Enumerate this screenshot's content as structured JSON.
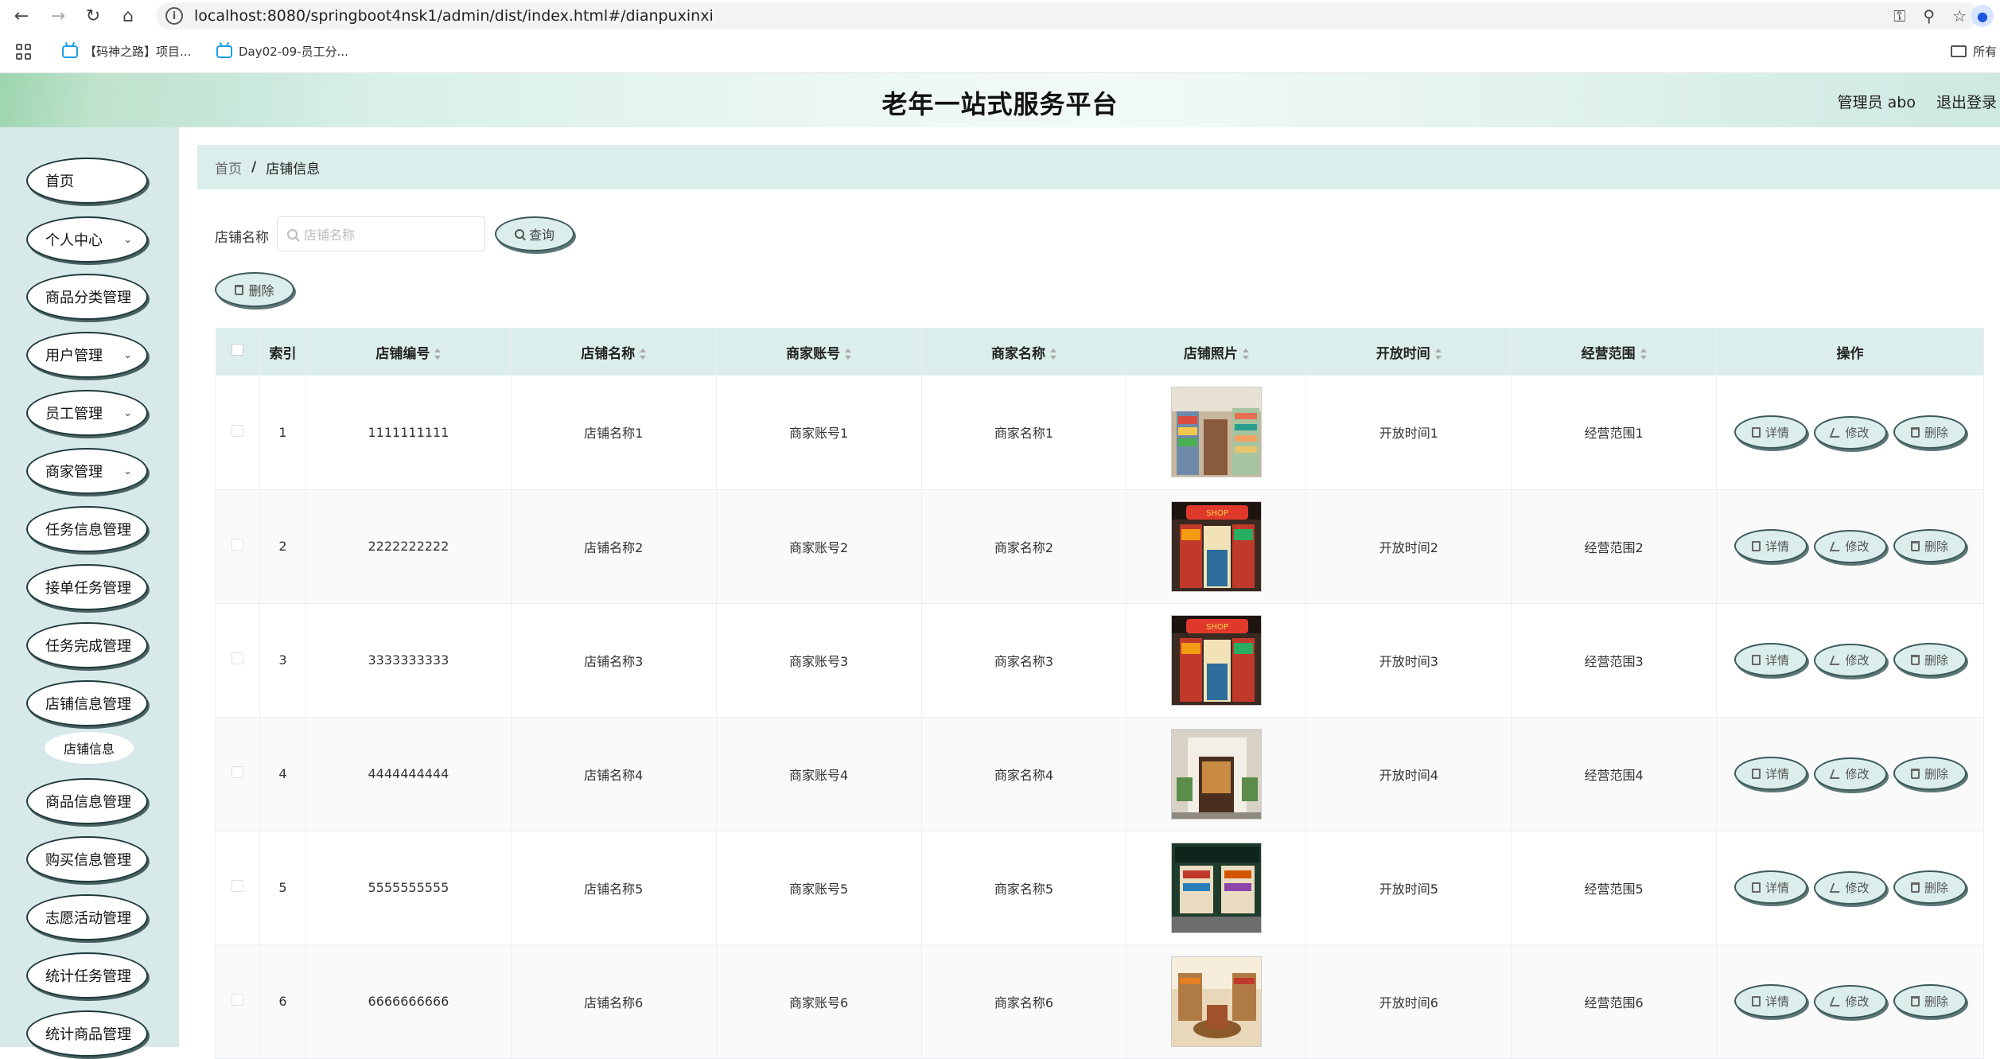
{
  "browser": {
    "url": "localhost:8080/springboot4nsk1/admin/dist/index.html#/dianpuxinxi",
    "bookmarks": [
      "【码神之路】项目...",
      "Day02-09-员工分..."
    ],
    "bookmarks_folder": "所有"
  },
  "header": {
    "title": "老年一站式服务平台",
    "admin_label": "管理员 abo",
    "logout_label": "退出登录"
  },
  "sidebar": {
    "items": [
      {
        "label": "首页",
        "expandable": false
      },
      {
        "label": "个人中心",
        "expandable": true
      },
      {
        "label": "商品分类管理",
        "expandable": false
      },
      {
        "label": "用户管理",
        "expandable": true
      },
      {
        "label": "员工管理",
        "expandable": true
      },
      {
        "label": "商家管理",
        "expandable": true
      },
      {
        "label": "任务信息管理",
        "expandable": false
      },
      {
        "label": "接单任务管理",
        "expandable": false
      },
      {
        "label": "任务完成管理",
        "expandable": false
      },
      {
        "label": "店铺信息管理",
        "expandable": false
      },
      {
        "label": "商品信息管理",
        "expandable": false
      },
      {
        "label": "购买信息管理",
        "expandable": false
      },
      {
        "label": "志愿活动管理",
        "expandable": false
      },
      {
        "label": "统计任务管理",
        "expandable": false
      },
      {
        "label": "统计商品管理",
        "expandable": false
      }
    ],
    "submenu": {
      "label": "店铺信息"
    }
  },
  "breadcrumb": {
    "home": "首页",
    "separator": "/",
    "current": "店铺信息"
  },
  "search": {
    "label": "店铺名称",
    "placeholder": "店铺名称",
    "query_button": "查询",
    "delete_button": "删除"
  },
  "table": {
    "columns": [
      "索引",
      "店铺编号",
      "店铺名称",
      "商家账号",
      "商家名称",
      "店铺照片",
      "开放时间",
      "经营范围",
      "操作"
    ],
    "sortable": [
      false,
      true,
      true,
      true,
      true,
      true,
      true,
      true,
      false
    ],
    "actions": {
      "detail": "详情",
      "edit": "修改",
      "delete": "删除"
    },
    "rows": [
      {
        "index": "1",
        "shop_no": "1111111111",
        "shop_name": "店铺名称1",
        "merchant_account": "商家账号1",
        "merchant_name": "商家名称1",
        "open_time": "开放时间1",
        "scope": "经营范围1",
        "photo": "shop-photo-1"
      },
      {
        "index": "2",
        "shop_no": "2222222222",
        "shop_name": "店铺名称2",
        "merchant_account": "商家账号2",
        "merchant_name": "商家名称2",
        "open_time": "开放时间2",
        "scope": "经营范围2",
        "photo": "shop-photo-2"
      },
      {
        "index": "3",
        "shop_no": "3333333333",
        "shop_name": "店铺名称3",
        "merchant_account": "商家账号3",
        "merchant_name": "商家名称3",
        "open_time": "开放时间3",
        "scope": "经营范围3",
        "photo": "shop-photo-3"
      },
      {
        "index": "4",
        "shop_no": "4444444444",
        "shop_name": "店铺名称4",
        "merchant_account": "商家账号4",
        "merchant_name": "商家名称4",
        "open_time": "开放时间4",
        "scope": "经营范围4",
        "photo": "shop-photo-4"
      },
      {
        "index": "5",
        "shop_no": "5555555555",
        "shop_name": "店铺名称5",
        "merchant_account": "商家账号5",
        "merchant_name": "商家名称5",
        "open_time": "开放时间5",
        "scope": "经营范围5",
        "photo": "shop-photo-5"
      },
      {
        "index": "6",
        "shop_no": "6666666666",
        "shop_name": "店铺名称6",
        "merchant_account": "商家账号6",
        "merchant_name": "商家名称6",
        "open_time": "开放时间6",
        "scope": "经营范围6",
        "photo": "shop-photo-6"
      }
    ]
  },
  "colors": {
    "accent_bg": "#dbeeec",
    "sidebar_bg": "#d7e9e8",
    "button_border": "#3d5a5a"
  }
}
